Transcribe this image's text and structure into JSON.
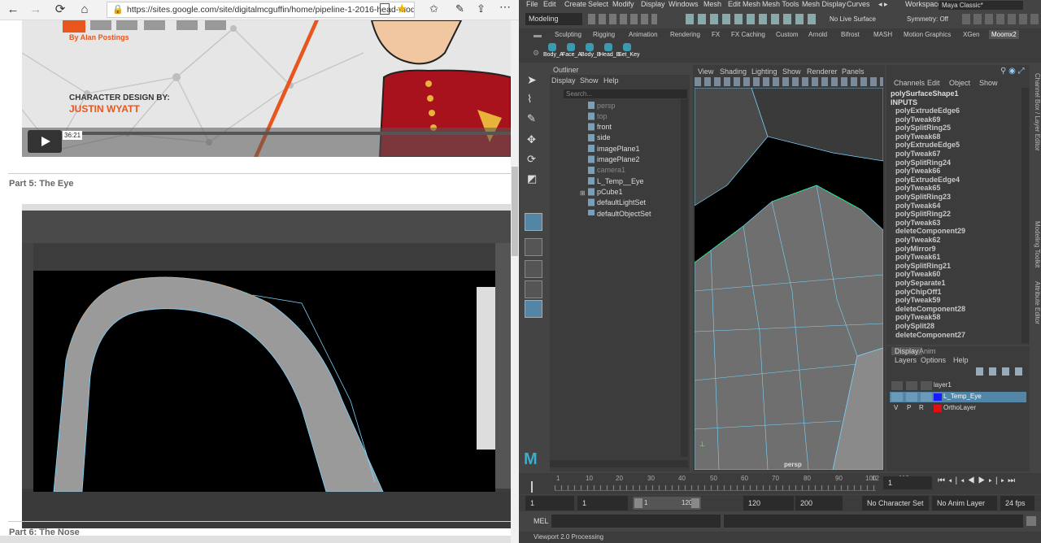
{
  "browser": {
    "url": "https://sites.google.com/site/digitalmcguffin/home/pipeline-1-2016-head-mode",
    "nav": {
      "back": "←",
      "forward": "→",
      "refresh": "⟳",
      "home": "⌂"
    },
    "video1": {
      "author": "By Alan Postings",
      "design_by": "CHARACTER DESIGN BY:",
      "designer": "JUSTIN WYATT",
      "time": "36:21"
    },
    "section_eye": "Part 5: The Eye",
    "section_nose": "Part 6: The Nose"
  },
  "maya": {
    "menu": [
      "File",
      "Edit",
      "Create",
      "Select",
      "Modify",
      "Display",
      "Windows",
      "Mesh",
      "Edit Mesh",
      "Mesh Tools",
      "Mesh Display",
      "Curves"
    ],
    "workspace_label": "Workspace :",
    "workspace_value": "Maya Classic*",
    "mode": "Modeling",
    "live_surface": "No Live Surface",
    "symmetry": "Symmetry: Off",
    "shelf_tabs": [
      "Sculpting",
      "Rigging",
      "Animation",
      "Rendering",
      "FX",
      "FX Caching",
      "Custom",
      "Arnold",
      "Bifrost",
      "MASH",
      "Motion Graphics",
      "XGen",
      "Moomx2"
    ],
    "shelf_buttons": [
      "Body_A",
      "Face_A",
      "Body_B",
      "Head_B",
      "Set_Key"
    ],
    "outliner": {
      "title": "Outliner",
      "menu": [
        "Display",
        "Show",
        "Help"
      ],
      "search": "Search...",
      "items": [
        "persp",
        "top",
        "front",
        "side",
        "imagePlane1",
        "imagePlane2",
        "camera1",
        "L_Temp__Eye",
        "pCube1",
        "defaultLightSet",
        "defaultObjectSet"
      ]
    },
    "viewport": {
      "menu": [
        "View",
        "Shading",
        "Lighting",
        "Show",
        "Renderer",
        "Panels"
      ],
      "camera": "persp"
    },
    "channel_box": {
      "menu": [
        "Channels",
        "Edit",
        "Object",
        "Show"
      ],
      "object": "polySurfaceShape1",
      "inputs_label": "INPUTS",
      "items": [
        "polyExtrudeEdge6",
        "polyTweak69",
        "polySplitRing25",
        "polyTweak68",
        "polyExtrudeEdge5",
        "polyTweak67",
        "polySplitRing24",
        "polyTweak66",
        "polyExtrudeEdge4",
        "polyTweak65",
        "polySplitRing23",
        "polyTweak64",
        "polySplitRing22",
        "polyTweak63",
        "deleteComponent29",
        "polyTweak62",
        "polyMirror9",
        "polyTweak61",
        "polySplitRing21",
        "polyTweak60",
        "polySeparate1",
        "polyChipOff1",
        "polyTweak59",
        "deleteComponent28",
        "polyTweak58",
        "polySplit28",
        "deleteComponent27"
      ]
    },
    "side_tabs": [
      "Channel Box / Layer Editor",
      "Modeling Toolkit",
      "Attribute Editor"
    ],
    "layers": {
      "tabs": [
        "Display",
        "Anim"
      ],
      "menu": [
        "Layers",
        "Options",
        "Help"
      ],
      "rows": [
        {
          "name": "layer1",
          "v": "",
          "p": "",
          "r": "",
          "color": "none"
        },
        {
          "name": "L_Temp_Eye",
          "v": "",
          "p": "",
          "r": "",
          "color": "#1a1aff"
        },
        {
          "name": "OrthoLayer",
          "v": "V",
          "p": "P",
          "r": "R",
          "color": "#e01010"
        }
      ]
    },
    "timeline": {
      "ticks": [
        "1",
        "10",
        "20",
        "30",
        "40",
        "50",
        "60",
        "70",
        "80",
        "90",
        "100",
        "110",
        "12"
      ],
      "current_frame": "1"
    },
    "range": {
      "start": "1",
      "start2": "1",
      "slider_start": "1",
      "slider_end": "120",
      "end": "120",
      "end2": "200",
      "char_set": "No Character Set",
      "anim_layer": "No Anim Layer",
      "fps": "24 fps"
    },
    "mel_label": "MEL",
    "status": "Viewport 2.0 Processing",
    "colors": {
      "accent": "#5285a6",
      "viewport_bg": "#000000",
      "wire": "#7ad6ff"
    }
  }
}
